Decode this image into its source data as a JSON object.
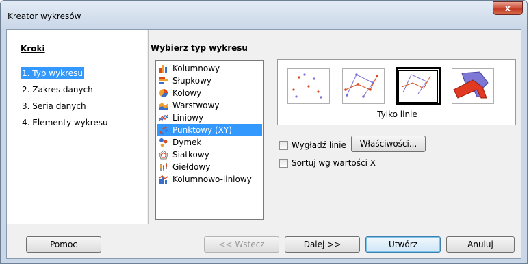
{
  "window": {
    "title": "Kreator wykresów",
    "close_label": "x"
  },
  "sidebar": {
    "title": "Kroki",
    "steps": [
      {
        "label": "1. Typ wykresu",
        "active": true
      },
      {
        "label": "2. Zakres danych",
        "active": false
      },
      {
        "label": "3. Seria danych",
        "active": false
      },
      {
        "label": "4. Elementy wykresu",
        "active": false
      }
    ]
  },
  "main": {
    "section_title": "Wybierz typ wykresu",
    "chart_types": [
      {
        "label": "Kolumnowy",
        "icon": "column-chart-icon"
      },
      {
        "label": "Słupkowy",
        "icon": "bar-chart-icon"
      },
      {
        "label": "Kołowy",
        "icon": "pie-chart-icon"
      },
      {
        "label": "Warstwowy",
        "icon": "area-chart-icon"
      },
      {
        "label": "Liniowy",
        "icon": "line-chart-icon"
      },
      {
        "label": "Punktowy (XY)",
        "icon": "scatter-chart-icon",
        "selected": true
      },
      {
        "label": "Dymek",
        "icon": "bubble-chart-icon"
      },
      {
        "label": "Siatkowy",
        "icon": "net-chart-icon"
      },
      {
        "label": "Giełdowy",
        "icon": "stock-chart-icon"
      },
      {
        "label": "Kolumnowo-liniowy",
        "icon": "column-line-chart-icon"
      }
    ],
    "variant_label": "Tylko linie",
    "variants": [
      {
        "name": "points-only-icon"
      },
      {
        "name": "points-and-lines-icon"
      },
      {
        "name": "lines-only-icon",
        "selected": true
      },
      {
        "name": "3d-lines-icon"
      }
    ],
    "options": {
      "smooth_label": "Wygładź linie",
      "properties_button": "Właściwości...",
      "sort_label": "Sortuj wg wartości X"
    }
  },
  "footer": {
    "help": "Pomoc",
    "back": "<< Wstecz",
    "next": "Dalej >>",
    "finish": "Utwórz",
    "cancel": "Anuluj"
  },
  "colors": {
    "selection": "#3399ff",
    "close": "#c7432b"
  }
}
